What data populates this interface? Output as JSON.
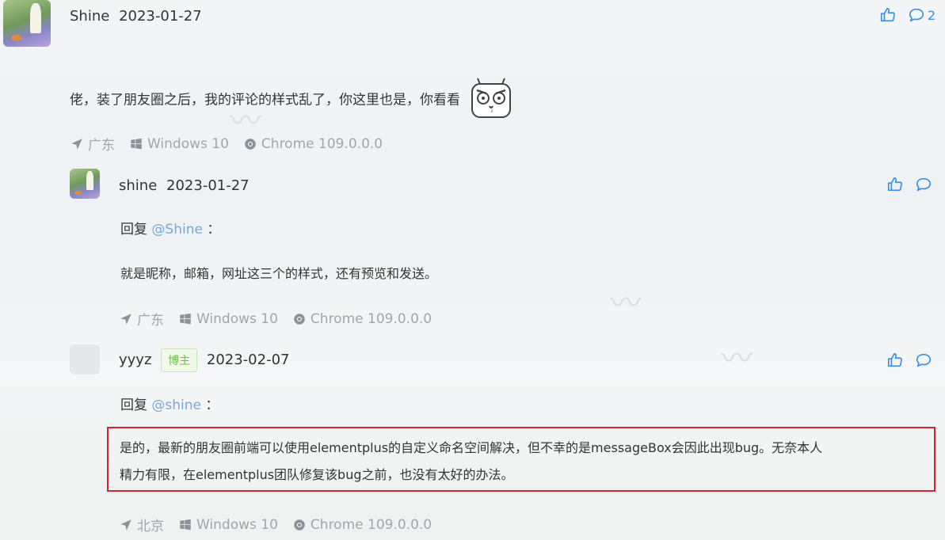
{
  "comment_main": {
    "author": "Shine",
    "date": "2023-01-27",
    "text": "佬，装了朋友圈之后，我的评论的样式乱了，你这里也是，你看看",
    "like_icon": "thumbs-up-icon",
    "reply_icon": "comment-icon",
    "reply_count": "2",
    "meta": {
      "location": "广东",
      "os": "Windows 10",
      "browser": "Chrome 109.0.0.0"
    }
  },
  "reply_1": {
    "author": "shine",
    "date": "2023-01-27",
    "reply_prefix": "回复",
    "reply_to": "@Shine",
    "reply_suffix": "：",
    "text": "就是昵称，邮箱，网址这三个的样式，还有预览和发送。",
    "meta": {
      "location": "广东",
      "os": "Windows 10",
      "browser": "Chrome 109.0.0.0"
    }
  },
  "reply_2": {
    "author": "yyyz",
    "badge": "博主",
    "date": "2023-02-07",
    "reply_prefix": "回复",
    "reply_to": "@shine",
    "reply_suffix": "：",
    "text_line1": "是的，最新的朋友圈前端可以使用elementplus的自定义命名空间解决，但不幸的是messageBox会因此出现bug。无奈本人",
    "text_line2": "精力有限，在elementplus团队修复该bug之前，也没有太好的办法。",
    "meta": {
      "location": "北京",
      "os": "Windows 10",
      "browser": "Chrome 109.0.0.0"
    }
  },
  "colors": {
    "accent": "#3a8ee6",
    "highlight_border": "#d9212c",
    "badge_green": "#67c23a",
    "meta_gray": "#a0a6ad"
  }
}
